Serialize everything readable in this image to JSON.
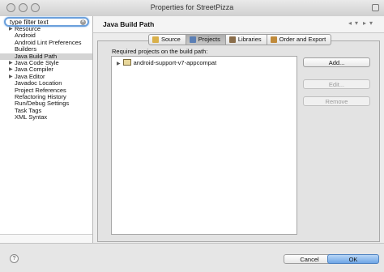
{
  "window": {
    "title": "Properties for StreetPizza"
  },
  "filter": {
    "value": "type filter text"
  },
  "tree": [
    {
      "label": "Resource",
      "expandable": true
    },
    {
      "label": "Android",
      "expandable": false
    },
    {
      "label": "Android Lint Preferences",
      "expandable": false
    },
    {
      "label": "Builders",
      "expandable": false
    },
    {
      "label": "Java Build Path",
      "expandable": false,
      "selected": true
    },
    {
      "label": "Java Code Style",
      "expandable": true
    },
    {
      "label": "Java Compiler",
      "expandable": true
    },
    {
      "label": "Java Editor",
      "expandable": true
    },
    {
      "label": "Javadoc Location",
      "expandable": false
    },
    {
      "label": "Project References",
      "expandable": false
    },
    {
      "label": "Refactoring History",
      "expandable": false
    },
    {
      "label": "Run/Debug Settings",
      "expandable": false
    },
    {
      "label": "Task Tags",
      "expandable": false
    },
    {
      "label": "XML Syntax",
      "expandable": false
    }
  ],
  "page": {
    "title": "Java Build Path"
  },
  "tabs": [
    {
      "label": "Source",
      "icon": "source-folder-icon",
      "color": "#d9b04a"
    },
    {
      "label": "Projects",
      "icon": "projects-icon",
      "color": "#5b7fb5",
      "active": true
    },
    {
      "label": "Libraries",
      "icon": "libraries-icon",
      "color": "#8a6d4a"
    },
    {
      "label": "Order and Export",
      "icon": "order-export-icon",
      "color": "#c08a3a"
    }
  ],
  "projects": {
    "label": "Required projects on the build path:",
    "items": [
      {
        "label": "android-support-v7-appcompat"
      }
    ]
  },
  "buttons": {
    "add": "Add...",
    "edit": "Edit...",
    "remove": "Remove"
  },
  "footer": {
    "cancel": "Cancel",
    "ok": "OK",
    "help": "?"
  },
  "colors": {
    "accent": "#6ea6e6",
    "selection": "#d4d4d4"
  }
}
